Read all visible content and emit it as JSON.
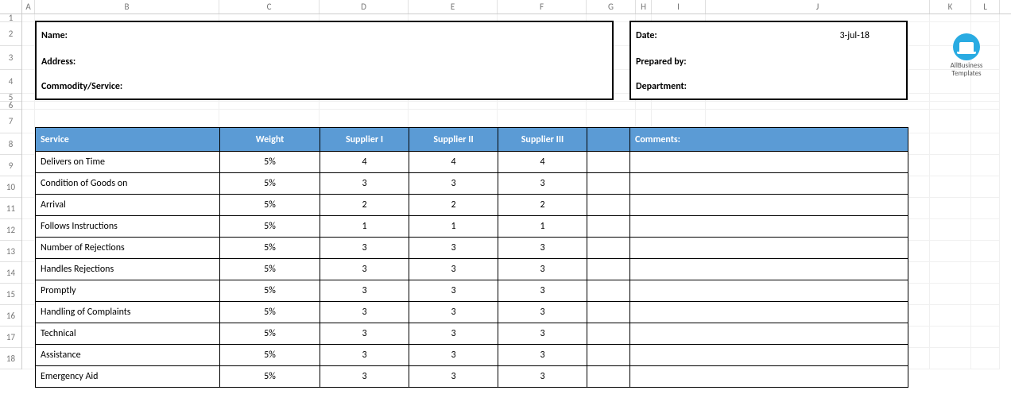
{
  "columns": [
    "A",
    "B",
    "C",
    "D",
    "E",
    "F",
    "G",
    "H",
    "I",
    "J",
    "K",
    "L"
  ],
  "rowCount": 18,
  "infoLeft": {
    "name_label": "Name:",
    "address_label": "Address:",
    "commodity_label": "Commodity/Service:"
  },
  "infoRight": {
    "date_label": "Date:",
    "date_value": "3-jul-18",
    "prepared_label": "Prepared by:",
    "department_label": "Department:"
  },
  "logo": {
    "line1": "AllBusiness",
    "line2": "Templates"
  },
  "table": {
    "headers": {
      "service": "Service",
      "weight": "Weight",
      "s1": "Supplier I",
      "s2": "Supplier II",
      "s3": "Supplier III"
    },
    "rows": [
      {
        "service": "Delivers on Time",
        "weight": "5%",
        "s1": "4",
        "s2": "4",
        "s3": "4"
      },
      {
        "service": "Condition of Goods on",
        "weight": "5%",
        "s1": "3",
        "s2": "3",
        "s3": "3"
      },
      {
        "service": "Arrival",
        "weight": "5%",
        "s1": "2",
        "s2": "2",
        "s3": "2"
      },
      {
        "service": "Follows Instructions",
        "weight": "5%",
        "s1": "1",
        "s2": "1",
        "s3": "1"
      },
      {
        "service": "Number of Rejections",
        "weight": "5%",
        "s1": "3",
        "s2": "3",
        "s3": "3"
      },
      {
        "service": "Handles Rejections",
        "weight": "5%",
        "s1": "3",
        "s2": "3",
        "s3": "3"
      },
      {
        "service": "Promptly",
        "weight": "5%",
        "s1": "3",
        "s2": "3",
        "s3": "3"
      },
      {
        "service": "Handling of Complaints",
        "weight": "5%",
        "s1": "3",
        "s2": "3",
        "s3": "3"
      },
      {
        "service": "Technical",
        "weight": "5%",
        "s1": "3",
        "s2": "3",
        "s3": "3"
      },
      {
        "service": "Assistance",
        "weight": "5%",
        "s1": "3",
        "s2": "3",
        "s3": "3"
      },
      {
        "service": "Emergency Aid",
        "weight": "5%",
        "s1": "3",
        "s2": "3",
        "s3": "3"
      }
    ]
  },
  "comments": {
    "header": "Comments:"
  }
}
